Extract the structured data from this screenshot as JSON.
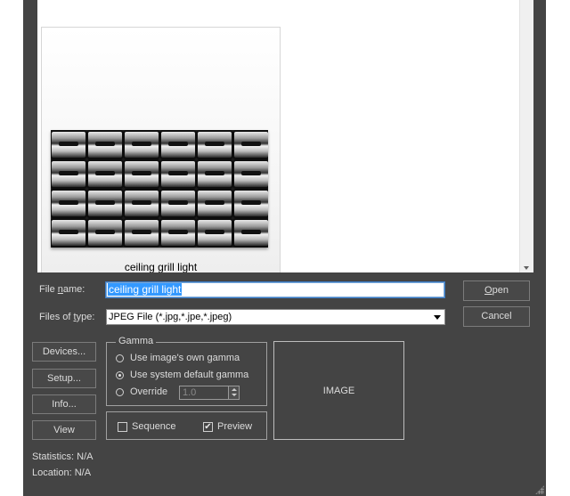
{
  "browser": {
    "item": {
      "name": "ceiling grill light"
    }
  },
  "form": {
    "filename_label_pre": "File ",
    "filename_label_u": "n",
    "filename_label_post": "ame:",
    "filename_value": "ceiling grill light",
    "filetype_label_pre": "Files of ",
    "filetype_label_u": "t",
    "filetype_label_post": "ype:",
    "filetype_value": "JPEG File (*.jpg,*.jpe,*.jpeg)"
  },
  "buttons": {
    "open_u": "O",
    "open_rest": "pen",
    "cancel": "Cancel",
    "devices": "Devices...",
    "setup": "Setup...",
    "info": "Info...",
    "view": "View"
  },
  "gamma": {
    "title": "Gamma",
    "options": [
      "Use image's own gamma",
      "Use system default gamma",
      "Override"
    ],
    "selected": "Use system default gamma",
    "override_value": "1.0"
  },
  "options": {
    "sequence_label": "Sequence",
    "sequence_checked": false,
    "preview_label": "Preview",
    "preview_checked": true
  },
  "preview": {
    "label": "IMAGE"
  },
  "stats": {
    "statistics_label": "Statistics:",
    "statistics_value": "N/A",
    "location_label": "Location:",
    "location_value": "N/A"
  },
  "colors": {
    "dialog_bg": "#444444",
    "selection": "#3399ff"
  }
}
